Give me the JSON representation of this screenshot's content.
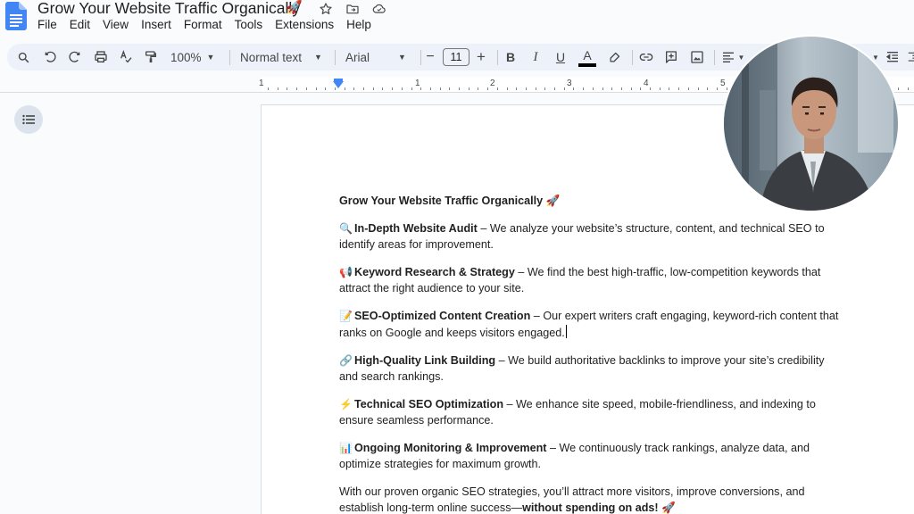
{
  "window": {
    "doc_title": "Grow Your Website Traffic Organically",
    "title_emoji": "🚀",
    "icons": [
      "star-icon",
      "move-to-folder-icon",
      "cloud-saved-icon"
    ]
  },
  "menu": [
    "File",
    "Edit",
    "View",
    "Insert",
    "Format",
    "Tools",
    "Extensions",
    "Help"
  ],
  "toolbar": {
    "zoom": "100%",
    "style": "Normal text",
    "font": "Arial",
    "font_size": "11",
    "minus": "−",
    "plus": "+",
    "bold": "B",
    "italic": "I",
    "underline": "U",
    "text_color": "A",
    "text_color_hex": "#000000"
  },
  "ruler": {
    "numbers": [
      "1",
      "1",
      "2",
      "3",
      "4",
      "5"
    ]
  },
  "document": {
    "heading": "Grow Your Website Traffic Organically",
    "heading_emoji": "🚀",
    "items": [
      {
        "emoji": "🔍",
        "title": "In-Depth Website Audit",
        "text": " – We analyze your website’s structure, content, and technical SEO to identify areas for improvement."
      },
      {
        "emoji": "📢",
        "title": "Keyword Research & Strategy",
        "text": " – We find the best high-traffic, low-competition keywords that attract the right audience to your site."
      },
      {
        "emoji": "📝",
        "title": "SEO-Optimized Content Creation",
        "text": " – Our expert writers craft engaging, keyword-rich content that ranks on Google and keeps visitors engaged."
      },
      {
        "emoji": "🔗",
        "title": "High-Quality Link Building",
        "text": " – We build authoritative backlinks to improve your site’s credibility and search rankings."
      },
      {
        "emoji": "⚡",
        "title": "Technical SEO Optimization",
        "text": " – We enhance site speed, mobile-friendliness, and indexing to ensure seamless performance."
      },
      {
        "emoji": "📊",
        "title": "Ongoing Monitoring & Improvement",
        "text": " – We continuously track rankings, analyze data, and optimize strategies for maximum growth."
      }
    ],
    "closing_text": "With our proven organic SEO strategies, you’ll attract more visitors, improve conversions, and establish long-term online success—",
    "closing_bold": "without spending on ads!",
    "closing_emoji": "🚀"
  },
  "colors": {
    "docs_blue": "#4285f4",
    "toolbar_bg": "#edf2fa",
    "page_bg": "#ffffff",
    "app_bg": "#f9fbfd"
  }
}
